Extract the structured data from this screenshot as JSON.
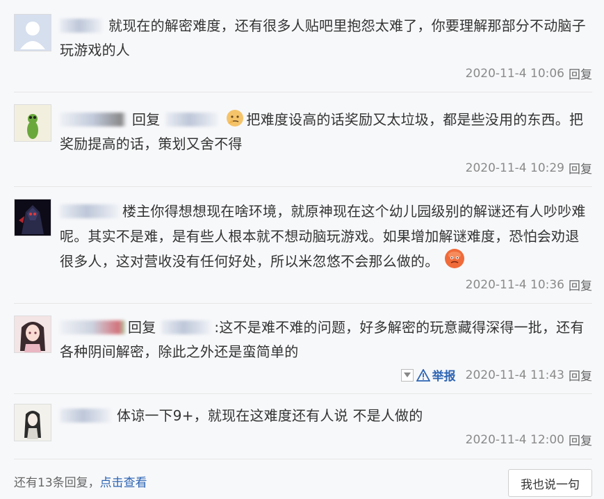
{
  "replies": [
    {
      "content": "就现在的解密难度，还有很多人贴吧里抱怨太难了，你要理解那部分不动脑子玩游戏的人",
      "time": "2020-11-4 10:06",
      "reply_label": "回复"
    },
    {
      "reply_word": "回复",
      "content": "把难度设高的话奖励又太垃圾，都是些没用的东西。把奖励提高的话，策划又舍不得",
      "time": "2020-11-4 10:29",
      "reply_label": "回复"
    },
    {
      "content": "楼主你得想想现在啥环境，就原神现在这个幼儿园级别的解谜还有人吵吵难呢。其实不是难，是有些人根本就不想动脑玩游戏。如果增加解谜难度，恐怕会劝退很多人，这对营收没有任何好处，所以米忽悠不会那么做的。",
      "time": "2020-11-4 10:36",
      "reply_label": "回复"
    },
    {
      "reply_word": "回复",
      "content": ":这不是难不难的问题，好多解密的玩意藏得深得一批，还有各种阴间解密，除此之外还是蛮简单的",
      "report_label": "举报",
      "time": "2020-11-4 11:43",
      "reply_label": "回复"
    },
    {
      "content": "体谅一下9+，就现在这难度还有人说 不是人做的",
      "time": "2020-11-4 12:00",
      "reply_label": "回复"
    }
  ],
  "footer": {
    "prefix": "还有13条回复，",
    "link": "点击查看",
    "button": "我也说一句"
  },
  "colors": {
    "link": "#2d64b3",
    "meta": "#8a8a8a",
    "background": "#f7f8fa"
  }
}
